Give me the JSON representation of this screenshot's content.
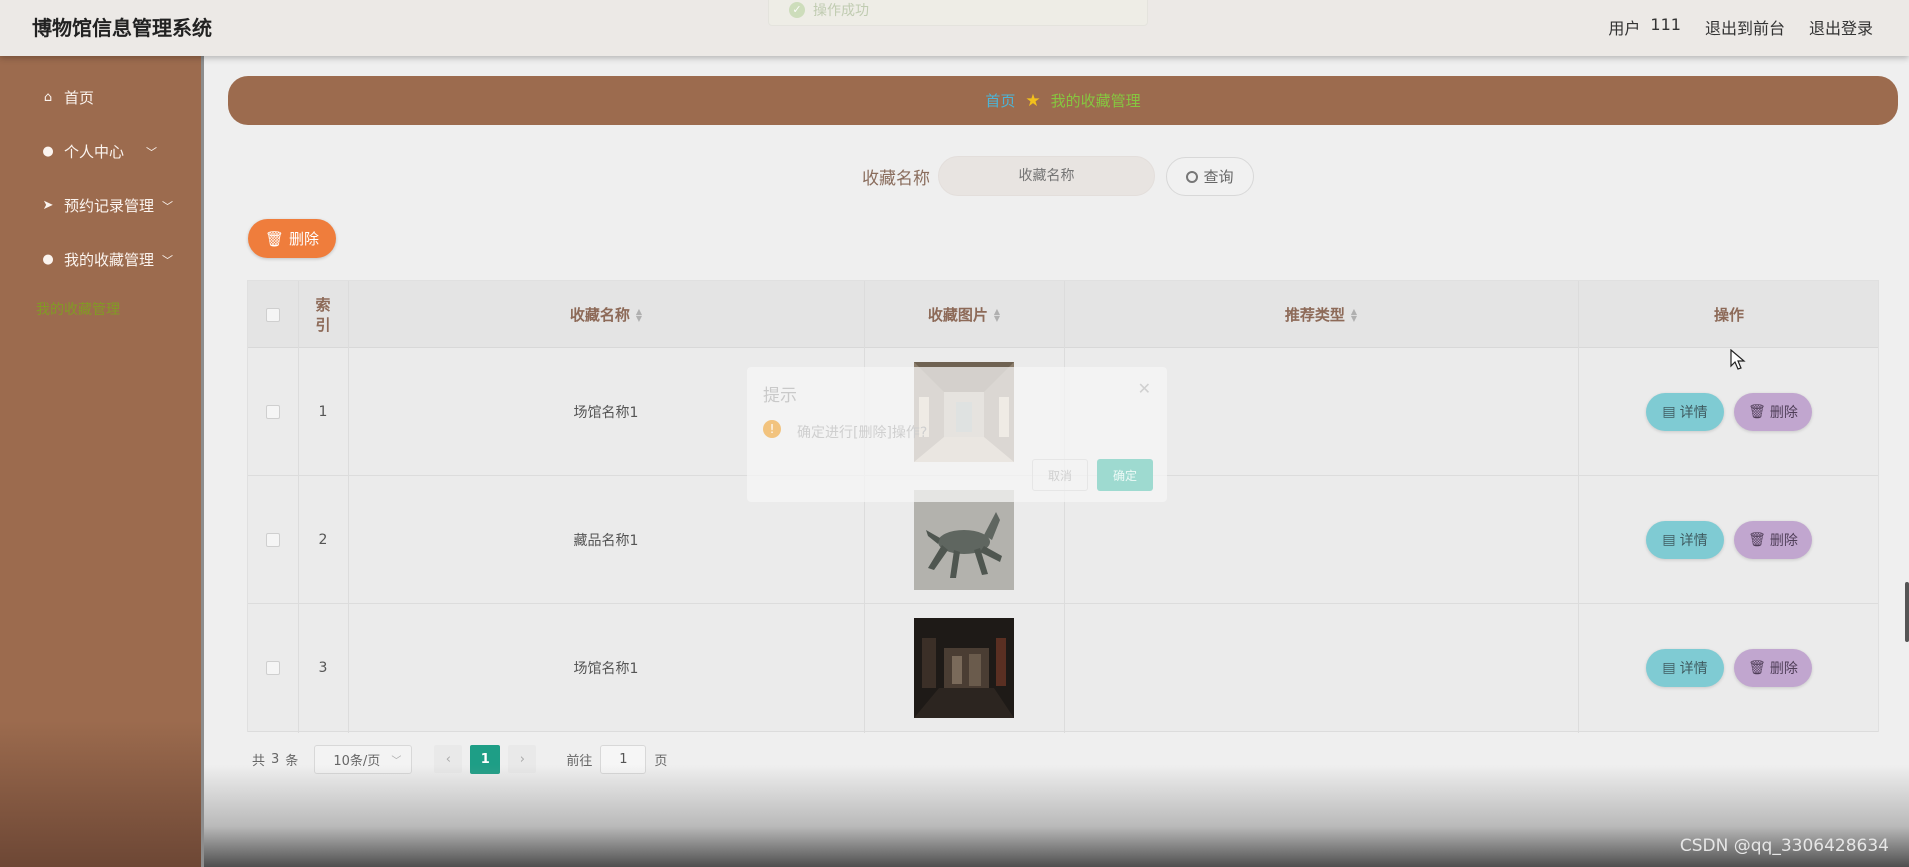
{
  "app": {
    "title": "博物馆信息管理系统"
  },
  "header": {
    "user_label": "用户",
    "user_name": "111",
    "to_front": "退出到前台",
    "logout": "退出登录"
  },
  "toast": {
    "text": "操作成功"
  },
  "sidebar": {
    "items": [
      {
        "label": "首页",
        "icon": "home-icon"
      },
      {
        "label": "个人中心",
        "icon": "user-icon"
      },
      {
        "label": "预约记录管理",
        "icon": "send-icon"
      },
      {
        "label": "我的收藏管理",
        "icon": "user-icon"
      }
    ],
    "sub_item": "我的收藏管理"
  },
  "breadcrumb": {
    "home": "首页",
    "current": "我的收藏管理"
  },
  "search": {
    "label": "收藏名称",
    "placeholder": "收藏名称",
    "button": "查询"
  },
  "toolbar": {
    "delete_label": "删除"
  },
  "table": {
    "headers": {
      "index": "索引",
      "name": "收藏名称",
      "image": "收藏图片",
      "type": "推荐类型",
      "ops": "操作"
    },
    "rows": [
      {
        "index": "1",
        "name": "场馆名称1",
        "image": "gallery-hall-image",
        "type": ""
      },
      {
        "index": "2",
        "name": "藏品名称1",
        "image": "bronze-horse-image",
        "type": ""
      },
      {
        "index": "3",
        "name": "场馆名称1",
        "image": "dark-exhibit-image",
        "type": ""
      }
    ],
    "detail_label": "详情",
    "delete_label": "删除"
  },
  "pagination": {
    "total_prefix": "共",
    "total": "3",
    "total_suffix": "条",
    "page_size": "10条/页",
    "current_page": "1",
    "goto_prefix": "前往",
    "goto_value": "1",
    "goto_suffix": "页"
  },
  "dialog": {
    "title": "提示",
    "message": "确定进行[删除]操作?",
    "cancel": "取消",
    "confirm": "确定"
  },
  "watermark": "CSDN @qq_3306428634",
  "colors": {
    "sidebar": "#9c6b4e",
    "accent_orange": "#ef7d3c",
    "detail_btn": "#7fcbd3",
    "delete_btn": "#c1a6cf",
    "page_active": "#1e9e86"
  }
}
